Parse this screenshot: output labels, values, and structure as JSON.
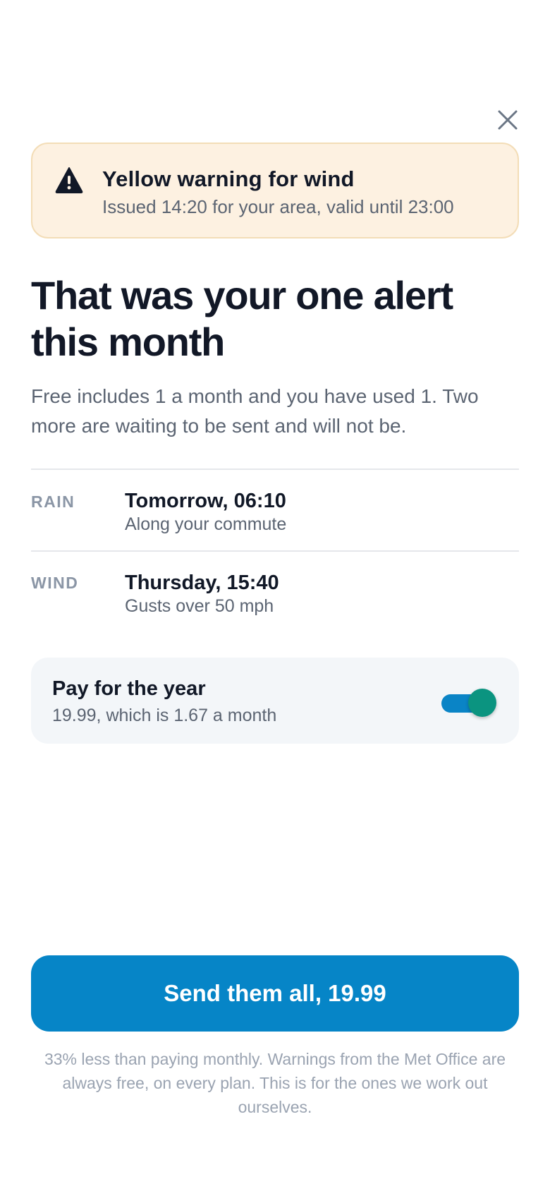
{
  "close": {
    "icon": "close-icon"
  },
  "warning": {
    "icon": "warning-triangle-icon",
    "title": "Yellow warning for wind",
    "subtitle": "Issued 14:20 for your area, valid until 23:00",
    "background": "#fdf1e1",
    "border": "#f3ddb7"
  },
  "headline": "That was your one alert this month",
  "intro": "Free includes 1 a month and you have used 1. Two more are waiting to be sent and will not be.",
  "pending_alerts": [
    {
      "type": "RAIN",
      "time": "Tomorrow, 06:10",
      "description": "Along your commute"
    },
    {
      "type": "WIND",
      "time": "Thursday, 15:40",
      "description": "Gusts over 50 mph"
    }
  ],
  "plan": {
    "title": "Pay for the year",
    "subtitle": "19.99, which is 1.67 a month",
    "toggle_on": true,
    "toggle_track_color": "#0a84c6",
    "toggle_knob_color": "#0b9480"
  },
  "cta": {
    "label": "Send them all, 19.99",
    "color": "#0685c7"
  },
  "footnote": "33% less than paying monthly. Warnings from the Met Office are always free, on every plan. This is for the ones we work out ourselves."
}
